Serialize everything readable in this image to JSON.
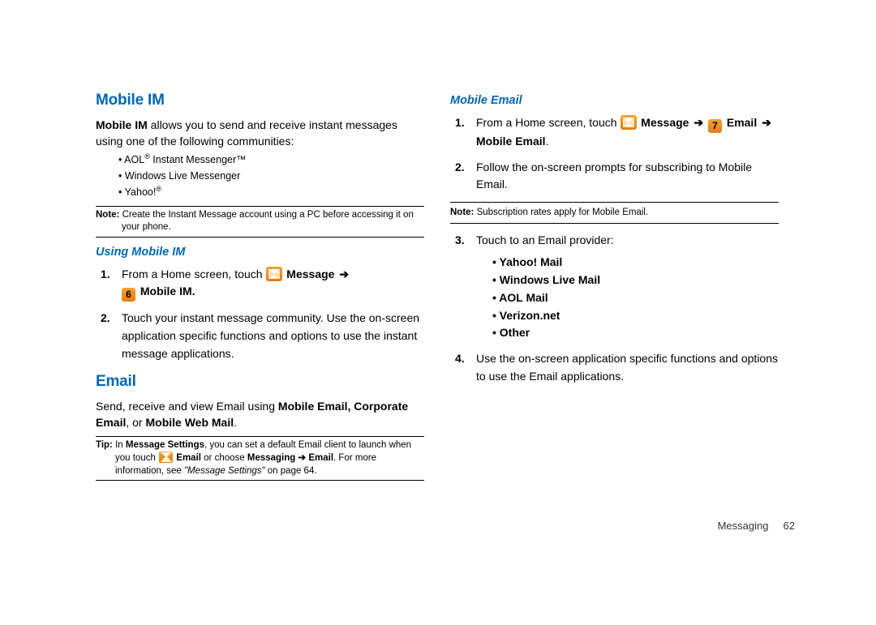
{
  "left": {
    "h1_mobile_im": "Mobile IM",
    "intro_bold": "Mobile IM",
    "intro_rest": " allows you to send and receive instant messages using one of the following communities:",
    "bullets": {
      "aol_pre": "AOL",
      "aol_sup": "®",
      "aol_post": " Instant Messenger™",
      "wlm": "Windows Live Messenger",
      "yahoo_pre": "Yahoo!",
      "yahoo_sup": "®"
    },
    "note1_label": "Note:",
    "note1_body": " Create the Instant Message account using a PC before accessing it on your phone.",
    "h2_using": "Using Mobile IM",
    "step1_pre": "From a Home screen, touch ",
    "step1_message": "Message",
    "step1_mobileim": "Mobile IM",
    "step1_period": ".",
    "step2": "Touch your instant message community. Use the on-screen application specific functions and options to use the instant message applications.",
    "h1_email": "Email",
    "email_para_pre": "Send, receive and view Email using ",
    "email_para_b1": "Mobile Email, Corporate Email",
    "email_para_mid": ", or ",
    "email_para_b2": "Mobile Web Mail",
    "email_para_end": ".",
    "tip_label": "Tip:",
    "tip_seg1": " In ",
    "tip_b1": "Message Settings",
    "tip_seg2": ", you can set a default Email client to launch when you touch ",
    "tip_b2": "Email",
    "tip_seg3": " or choose ",
    "tip_b3": "Messaging",
    "tip_arrow": " ➔ ",
    "tip_b4": "Email",
    "tip_seg4": ".  For more information, see ",
    "tip_italic": "\"Message Settings\"",
    "tip_seg5": " on page 64."
  },
  "right": {
    "h2_mobile_email": "Mobile Email",
    "r_step1_pre": "From a Home screen, touch ",
    "r_step1_message": "Message",
    "r_step1_email": "Email",
    "r_step1_me": "Mobile Email",
    "r_step1_period": ".",
    "r_step2": "Follow the on-screen prompts for subscribing to Mobile Email.",
    "r_note_label": "Note:",
    "r_note_body": " Subscription rates apply for Mobile Email.",
    "r_step3": "Touch to an Email provider:",
    "providers": {
      "p1": "• Yahoo! Mail",
      "p2": "• Windows Live Mail",
      "p3": "• AOL Mail",
      "p4": "• Verizon.net",
      "p5": "• Other"
    },
    "r_step4": "Use the on-screen application specific functions and options to use the Email applications.",
    "num6": "6",
    "num7": "7"
  },
  "footer": {
    "section": "Messaging",
    "page": "62"
  },
  "step_nums": {
    "n1": "1.",
    "n2": "2.",
    "n3": "3.",
    "n4": "4."
  }
}
